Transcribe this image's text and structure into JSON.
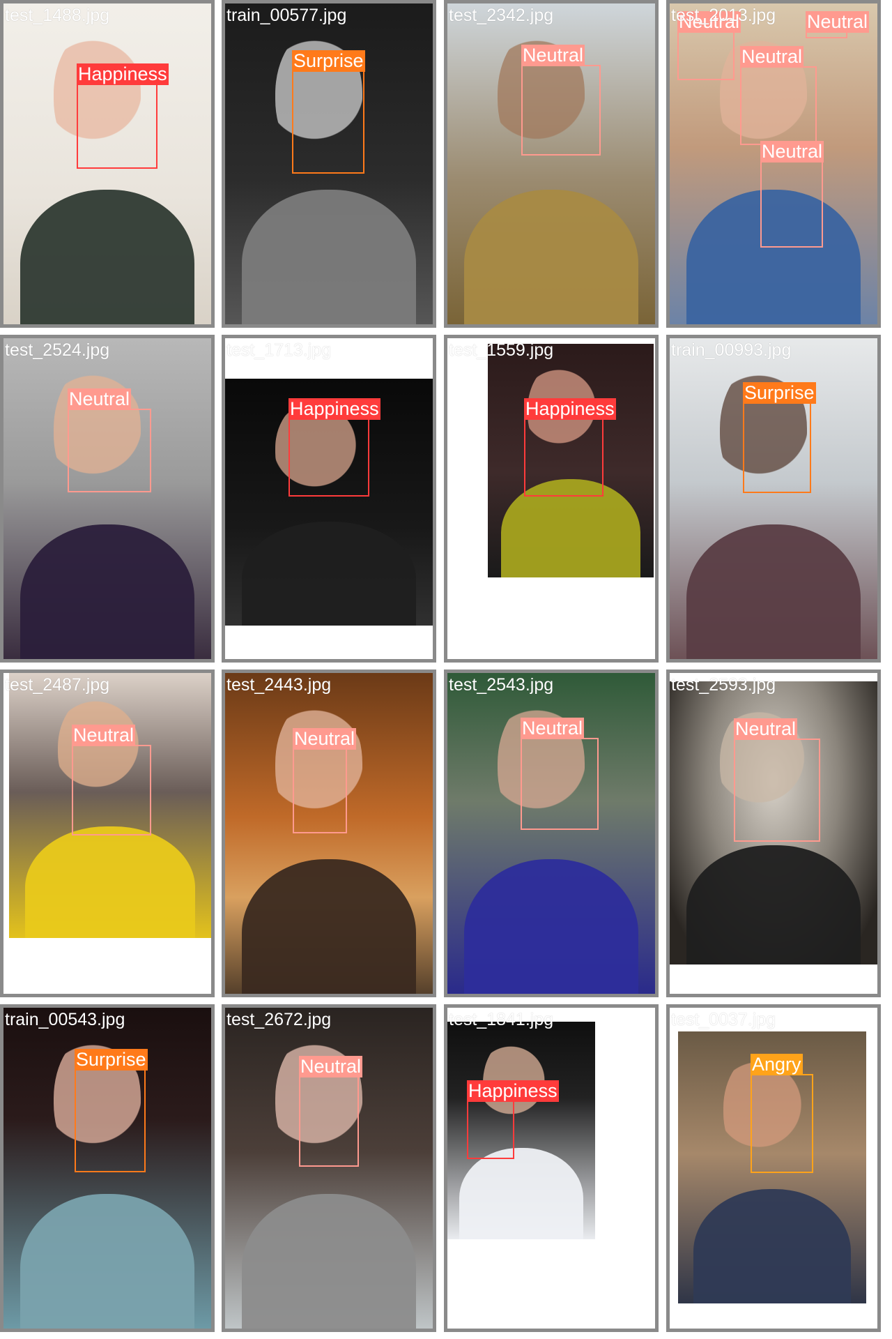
{
  "colors": {
    "happiness": "#ff3b3b",
    "surprise": "#ff7a1a",
    "neutral": "#ff9a8f",
    "angry": "#ffa31a",
    "tile_border": "#8a8a8a"
  },
  "tiles": [
    {
      "filename": "test_1488.jpg",
      "labels": [
        "Happiness"
      ]
    },
    {
      "filename": "train_00577.jpg",
      "labels": [
        "Surprise"
      ]
    },
    {
      "filename": "test_2342.jpg",
      "labels": [
        "Neutral"
      ]
    },
    {
      "filename": "test_2013.jpg",
      "labels": [
        "Neutral",
        "Neutral",
        "Neutral",
        "Neutral"
      ]
    },
    {
      "filename": "test_2524.jpg",
      "labels": [
        "Neutral"
      ]
    },
    {
      "filename": "test_1713.jpg",
      "labels": [
        "Happiness"
      ]
    },
    {
      "filename": "test_1559.jpg",
      "labels": [
        "Happiness"
      ]
    },
    {
      "filename": "train_00993.jpg",
      "labels": [
        "Surprise"
      ]
    },
    {
      "filename": "test_2487.jpg",
      "labels": [
        "Neutral"
      ]
    },
    {
      "filename": "test_2443.jpg",
      "labels": [
        "Neutral"
      ]
    },
    {
      "filename": "test_2543.jpg",
      "labels": [
        "Neutral"
      ]
    },
    {
      "filename": "test_2593.jpg",
      "labels": [
        "Neutral"
      ]
    },
    {
      "filename": "train_00543.jpg",
      "labels": [
        "Surprise"
      ]
    },
    {
      "filename": "test_2672.jpg",
      "labels": [
        "Neutral"
      ]
    },
    {
      "filename": "test_1841.jpg",
      "labels": [
        "Happiness"
      ]
    },
    {
      "filename": "test_0037.jpg",
      "labels": [
        "Angry"
      ]
    }
  ]
}
